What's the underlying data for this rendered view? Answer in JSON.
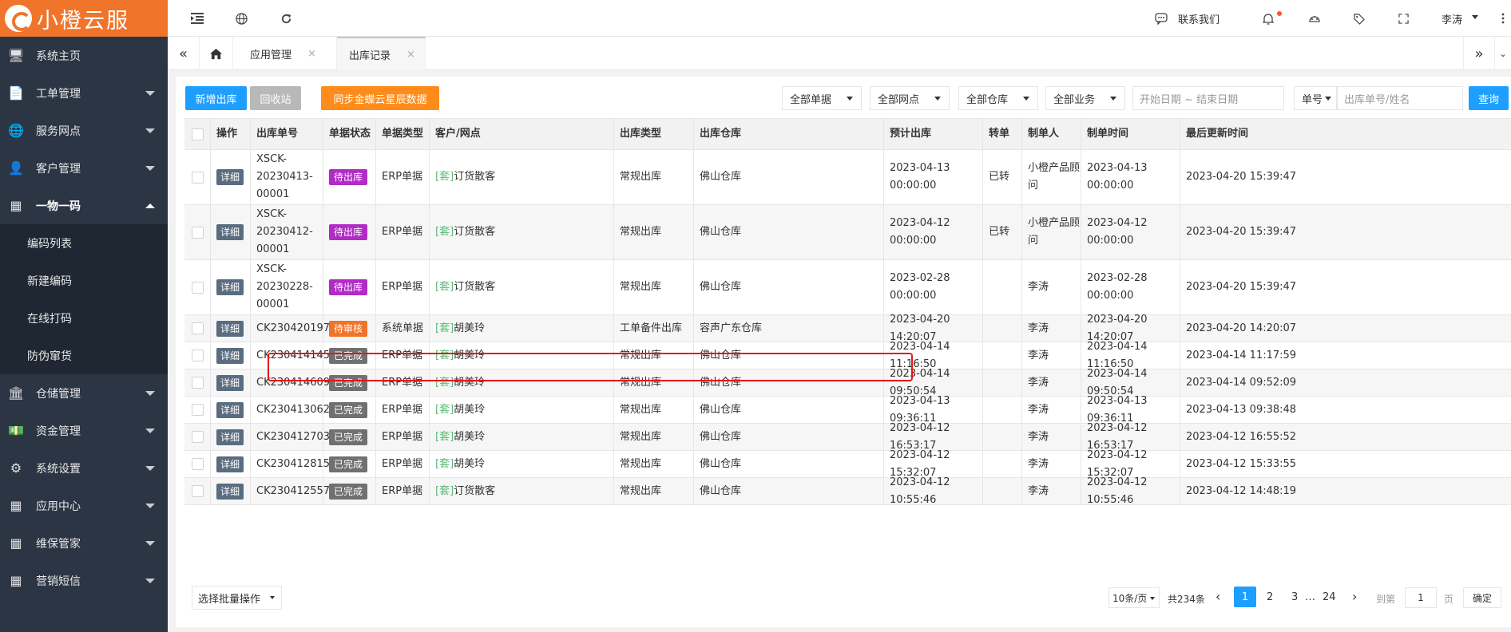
{
  "brand": {
    "name": "小橙云服"
  },
  "sidebar": {
    "items": [
      {
        "label": "系统主页",
        "icon": "monitor-icon",
        "glyph": "🖥"
      },
      {
        "label": "工单管理",
        "icon": "document-icon",
        "glyph": "📄"
      },
      {
        "label": "服务网点",
        "icon": "globe-icon",
        "glyph": "🌐"
      },
      {
        "label": "客户管理",
        "icon": "user-icon",
        "glyph": "👤"
      },
      {
        "label": "一物一码",
        "icon": "grid-icon",
        "glyph": "▦"
      },
      {
        "label": "仓储管理",
        "icon": "bank-icon",
        "glyph": "🏛"
      },
      {
        "label": "资金管理",
        "icon": "money-icon",
        "glyph": "💵"
      },
      {
        "label": "系统设置",
        "icon": "gear-icon",
        "glyph": "⚙"
      },
      {
        "label": "应用中心",
        "icon": "grid-icon",
        "glyph": "▦"
      },
      {
        "label": "维保管家",
        "icon": "grid-icon",
        "glyph": "▦"
      },
      {
        "label": "营销短信",
        "icon": "grid-icon",
        "glyph": "▦"
      }
    ],
    "subitems": [
      "编码列表",
      "新建编码",
      "在线打码",
      "防伪窜货"
    ]
  },
  "topbar": {
    "contact_label": "联系我们",
    "user_name": "李涛"
  },
  "tabs": {
    "items": [
      "应用管理",
      "出库记录"
    ]
  },
  "toolbar": {
    "new_button": "新增出库",
    "recycle_button": "回收站",
    "sync_button": "同步金蝶云星辰数据",
    "filters": [
      "全部单据",
      "全部网点",
      "全部仓库",
      "全部业务"
    ],
    "date_placeholder": "开始日期 ~ 结束日期",
    "field_select": "单号",
    "search_placeholder": "出库单号/姓名",
    "query_button": "查询"
  },
  "table": {
    "columns": [
      "操作",
      "出库单号",
      "单据状态",
      "单据类型",
      "客户/网点",
      "出库类型",
      "出库仓库",
      "预计出库",
      "转单",
      "制单人",
      "制单时间",
      "最后更新时间"
    ],
    "detail_label": "详细",
    "tag": "[套]",
    "rows": [
      {
        "id": [
          "XSCK-",
          "20230413-",
          "00001"
        ],
        "status": "待出库",
        "status_color": "#b02cc5",
        "doc_type": "ERP单据",
        "customer": "订货散客",
        "out_type": "常规出库",
        "warehouse": "佛山仓库",
        "expected": "2023-04-13 00:00:00",
        "transfer": "已转",
        "creator": [
          "小橙产品顾",
          "问"
        ],
        "created": "2023-04-13 00:00:00",
        "updated": "2023-04-20 15:39:47"
      },
      {
        "id": [
          "XSCK-",
          "20230412-",
          "00001"
        ],
        "status": "待出库",
        "status_color": "#b02cc5",
        "doc_type": "ERP单据",
        "customer": "订货散客",
        "out_type": "常规出库",
        "warehouse": "佛山仓库",
        "expected": "2023-04-12 00:00:00",
        "transfer": "已转",
        "creator": [
          "小橙产品顾",
          "问"
        ],
        "created": "2023-04-12 00:00:00",
        "updated": "2023-04-20 15:39:47"
      },
      {
        "id": [
          "XSCK-",
          "20230228-",
          "00001"
        ],
        "status": "待出库",
        "status_color": "#b02cc5",
        "doc_type": "ERP单据",
        "customer": "订货散客",
        "out_type": "常规出库",
        "warehouse": "佛山仓库",
        "expected": "2023-02-28 00:00:00",
        "transfer": "",
        "creator": [
          "李涛"
        ],
        "created": "2023-02-28 00:00:00",
        "updated": "2023-04-20 15:39:47"
      },
      {
        "id": [
          "CK2304201978"
        ],
        "status": "待审核",
        "status_color": "#f0742a",
        "doc_type": "系统单据",
        "customer": "胡美玲",
        "out_type": "工单备件出库",
        "warehouse": "容声广东仓库",
        "expected": "2023-04-20 14:20:07",
        "transfer": "",
        "creator": [
          "李涛"
        ],
        "created": "2023-04-20 14:20:07",
        "updated": "2023-04-20 14:20:07"
      },
      {
        "id": [
          "CK2304141456"
        ],
        "status": "已完成",
        "status_color": "#707070",
        "doc_type": "ERP单据",
        "customer": "胡美玲",
        "out_type": "常规出库",
        "warehouse": "佛山仓库",
        "expected": "2023-04-14 11:16:50",
        "transfer": "",
        "creator": [
          "李涛"
        ],
        "created": "2023-04-14 11:16:50",
        "updated": "2023-04-14 11:17:59"
      },
      {
        "id": [
          "CK2304146099"
        ],
        "status": "已完成",
        "status_color": "#707070",
        "doc_type": "ERP单据",
        "customer": "胡美玲",
        "out_type": "常规出库",
        "warehouse": "佛山仓库",
        "expected": "2023-04-14 09:50:54",
        "transfer": "",
        "creator": [
          "李涛"
        ],
        "created": "2023-04-14 09:50:54",
        "updated": "2023-04-14 09:52:09"
      },
      {
        "id": [
          "CK2304130629"
        ],
        "status": "已完成",
        "status_color": "#707070",
        "doc_type": "ERP单据",
        "customer": "胡美玲",
        "out_type": "常规出库",
        "warehouse": "佛山仓库",
        "expected": "2023-04-13 09:36:11",
        "transfer": "",
        "creator": [
          "李涛"
        ],
        "created": "2023-04-13 09:36:11",
        "updated": "2023-04-13 09:38:48"
      },
      {
        "id": [
          "CK2304127032"
        ],
        "status": "已完成",
        "status_color": "#707070",
        "doc_type": "ERP单据",
        "customer": "胡美玲",
        "out_type": "常规出库",
        "warehouse": "佛山仓库",
        "expected": "2023-04-12 16:53:17",
        "transfer": "",
        "creator": [
          "李涛"
        ],
        "created": "2023-04-12 16:53:17",
        "updated": "2023-04-12 16:55:52"
      },
      {
        "id": [
          "CK2304128159"
        ],
        "status": "已完成",
        "status_color": "#707070",
        "doc_type": "ERP单据",
        "customer": "胡美玲",
        "out_type": "常规出库",
        "warehouse": "佛山仓库",
        "expected": "2023-04-12 15:32:07",
        "transfer": "",
        "creator": [
          "李涛"
        ],
        "created": "2023-04-12 15:32:07",
        "updated": "2023-04-12 15:33:55"
      },
      {
        "id": [
          "CK2304125577"
        ],
        "status": "已完成",
        "status_color": "#707070",
        "doc_type": "ERP单据",
        "customer": "订货散客",
        "out_type": "常规出库",
        "warehouse": "佛山仓库",
        "expected": "2023-04-12 10:55:46",
        "transfer": "",
        "creator": [
          "李涛"
        ],
        "created": "2023-04-12 10:55:46",
        "updated": "2023-04-12 14:48:19"
      }
    ]
  },
  "pager": {
    "batch_label": "选择批量操作",
    "page_size": "10条/页",
    "total": "共234条",
    "pages": [
      "1",
      "2",
      "3",
      "…",
      "24"
    ],
    "current_page": "1",
    "goto_label": "到第",
    "goto_value": "1",
    "page_unit": "页",
    "confirm": "确定"
  },
  "colors": {
    "brand": "#f0742a",
    "primary": "#1e9fff",
    "sidebar": "#2b3544",
    "sync": "#ff8c1a",
    "recycle": "#b8b8b8",
    "highlight": "#e4161a"
  }
}
